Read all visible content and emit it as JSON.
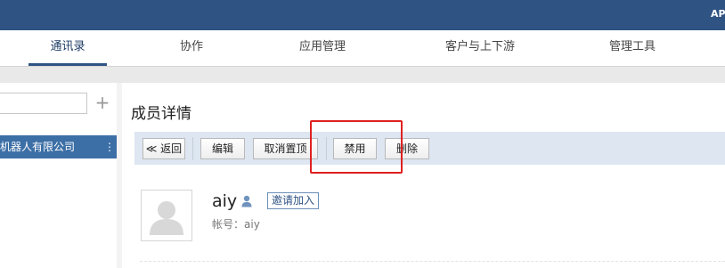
{
  "topbar": {
    "app_label": "AP"
  },
  "nav": {
    "tabs": [
      {
        "label": "通讯录",
        "active": true
      },
      {
        "label": "协作"
      },
      {
        "label": "应用管理"
      },
      {
        "label": "客户与上下游"
      },
      {
        "label": "管理工具"
      }
    ]
  },
  "sidebar": {
    "search_value": "",
    "org_name": "机器人有限公司",
    "more_icon": "⋮",
    "add_icon": "+"
  },
  "main": {
    "title": "成员详情",
    "toolbar": {
      "back": "≪ 返回",
      "edit": "编辑",
      "unpin": "取消置顶",
      "disable": "禁用",
      "delete": "删除"
    },
    "member": {
      "name": "aiy",
      "invite": "邀请加入",
      "account": "帐号：aiy"
    }
  },
  "colors": {
    "topbar": "#2f5383",
    "org_highlight": "#3c6fa6",
    "toolbar_bg": "#dde6f1",
    "annotation_box": "#e02020"
  }
}
